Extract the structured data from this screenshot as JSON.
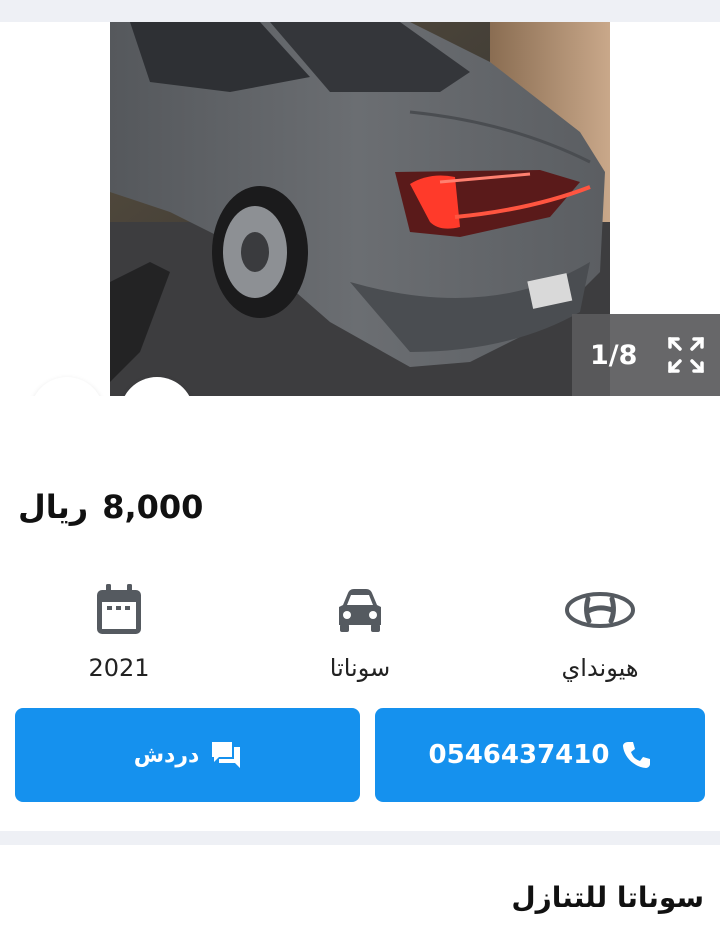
{
  "gallery": {
    "counter": "1/8",
    "icons": {
      "prev": "chevron-left-icon",
      "next": "chevron-right-icon",
      "expand": "expand-icon",
      "favorite": "heart-icon",
      "share": "share-icon"
    }
  },
  "listing": {
    "price_amount": "8,000",
    "price_currency": "ريال",
    "specs": {
      "year": "2021",
      "model": "سوناتا",
      "make": "هيونداي"
    },
    "actions": {
      "chat_label": "دردش",
      "phone_label": "0546437410"
    },
    "title": "سوناتا للتنازل"
  },
  "colors": {
    "primary": "#1591ee",
    "heart": "#e0484f",
    "background": "#eef0f5"
  }
}
